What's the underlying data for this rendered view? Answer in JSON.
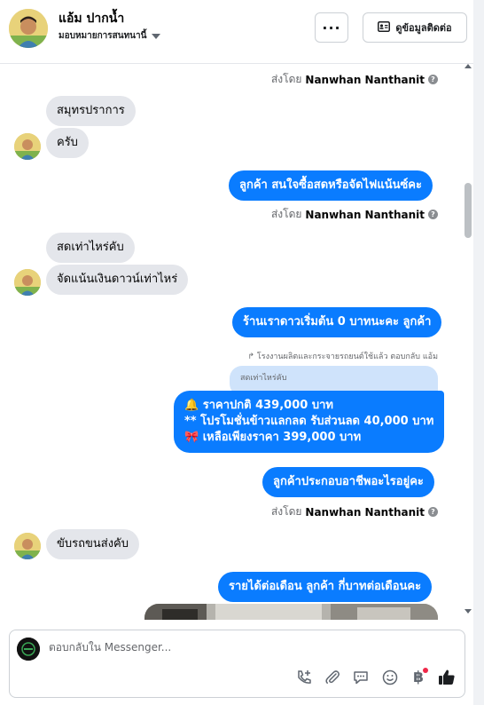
{
  "header": {
    "name": "แอ้ม ปากน้ำ",
    "assign_label": "มอบหมายการสนทนานี้",
    "more_label": "···",
    "contact_label": "ดูข้อมูลติดต่อ"
  },
  "sent_by": {
    "prefix": "ส่งโดย",
    "name": "Nanwhan Nanthanit"
  },
  "messages": {
    "in_1": "สมุทรปราการ",
    "in_2": "ครับ",
    "out_1": "ลูกค้า สนใจซื้อสดหรือจัดไฟแน้นซ์คะ",
    "in_3": "สดเท่าไหร่คับ",
    "in_4": "จัดแน้นเงินดาวน์เท่าไหร่",
    "out_2": "ร้านเราดาวเริ่มต้น 0 บาทนะคะ ลูกค้า",
    "reply_note": "โรงงานผลิตและกระจายรถยนต์ใช้แล้ว ตอบกลับ แอ้ม",
    "quoted": "สดเท่าไหร่คับ",
    "out_3_line1": "🔔 ราคาปกติ 439,000 บาท",
    "out_3_line2": "** โปรโมชั่นข้าวแลกลด รับส่วนลด 40,000 บาท",
    "out_3_line3": "🎀  เหลือเพียงราคา 399,000 บาท",
    "out_4": "ลูกค้าประกอบอาชีพอะไรอยู่คะ",
    "in_5": "ขับรถขนส่งคับ",
    "out_5": "รายได้ต่อเดือน ลูกค้า กี่บาทต่อเดือนคะ"
  },
  "composer": {
    "placeholder": "ตอบกลับใน Messenger..."
  },
  "icons": {
    "question": "?",
    "baht": "฿"
  },
  "colors": {
    "outgoing_bubble": "#0a7cff",
    "incoming_bubble": "#e4e6eb",
    "quoted_bubble": "#cfe3fb"
  }
}
